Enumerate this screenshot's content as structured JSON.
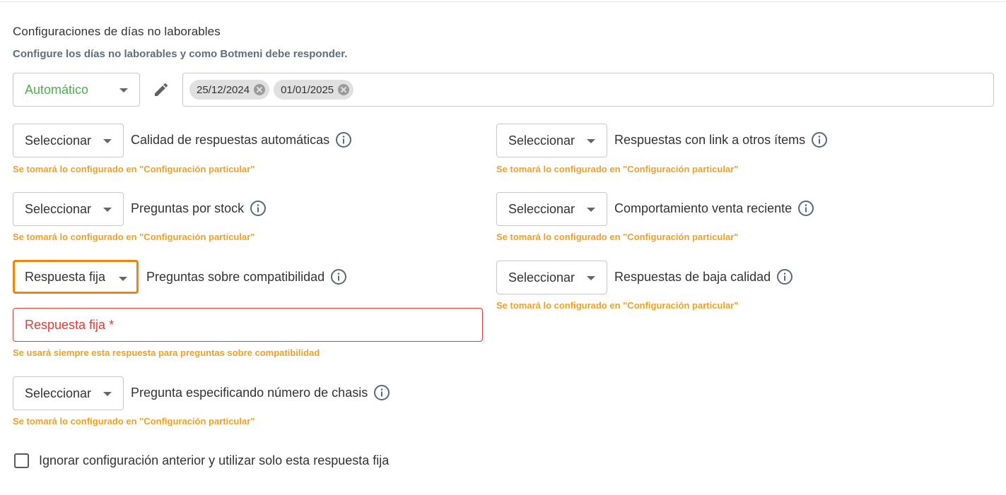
{
  "header": {
    "title": "Configuraciones de días no laborables",
    "subtitle": "Configure los días no laborables y como Botmeni debe responder."
  },
  "mode": {
    "value": "Automático",
    "accent": "#4caf50"
  },
  "dates": [
    {
      "label": "25/12/2024"
    },
    {
      "label": "01/01/2025"
    }
  ],
  "settings": {
    "calidad": {
      "select": "Seleccionar",
      "label": "Calidad de respuestas automáticas",
      "hint": "Se tomará lo configurado en \"Configuración particular\""
    },
    "link": {
      "select": "Seleccionar",
      "label": "Respuestas con link a otros ítems",
      "hint": "Se tomará lo configurado en \"Configuración particular\""
    },
    "stock": {
      "select": "Seleccionar",
      "label": "Preguntas por stock",
      "hint": "Se tomará lo configurado en \"Configuración particular\""
    },
    "venta": {
      "select": "Seleccionar",
      "label": "Comportamiento venta reciente",
      "hint": "Se tomará lo configurado en \"Configuración particular\""
    },
    "compat": {
      "select": "Respuesta fija",
      "label": "Preguntas sobre compatibilidad"
    },
    "baja": {
      "select": "Seleccionar",
      "label": "Respuestas de baja calidad",
      "hint": "Se tomará lo configurado en \"Configuración particular\""
    },
    "chasis": {
      "select": "Seleccionar",
      "label": "Pregunta especificando número de chasis",
      "hint": "Se tomará lo configurado en \"Configuración particular\""
    }
  },
  "fixed_answer": {
    "placeholder": "Respuesta fija *",
    "hint": "Se usará siempre esta respuesta para preguntas sobre compatibilidad"
  },
  "ignore_checkbox": {
    "label": "Ignorar configuración anterior y utilizar solo esta respuesta fija",
    "checked": false
  },
  "colors": {
    "hint": "#f0a028",
    "error": "#e53935",
    "focus": "#f5820d"
  }
}
